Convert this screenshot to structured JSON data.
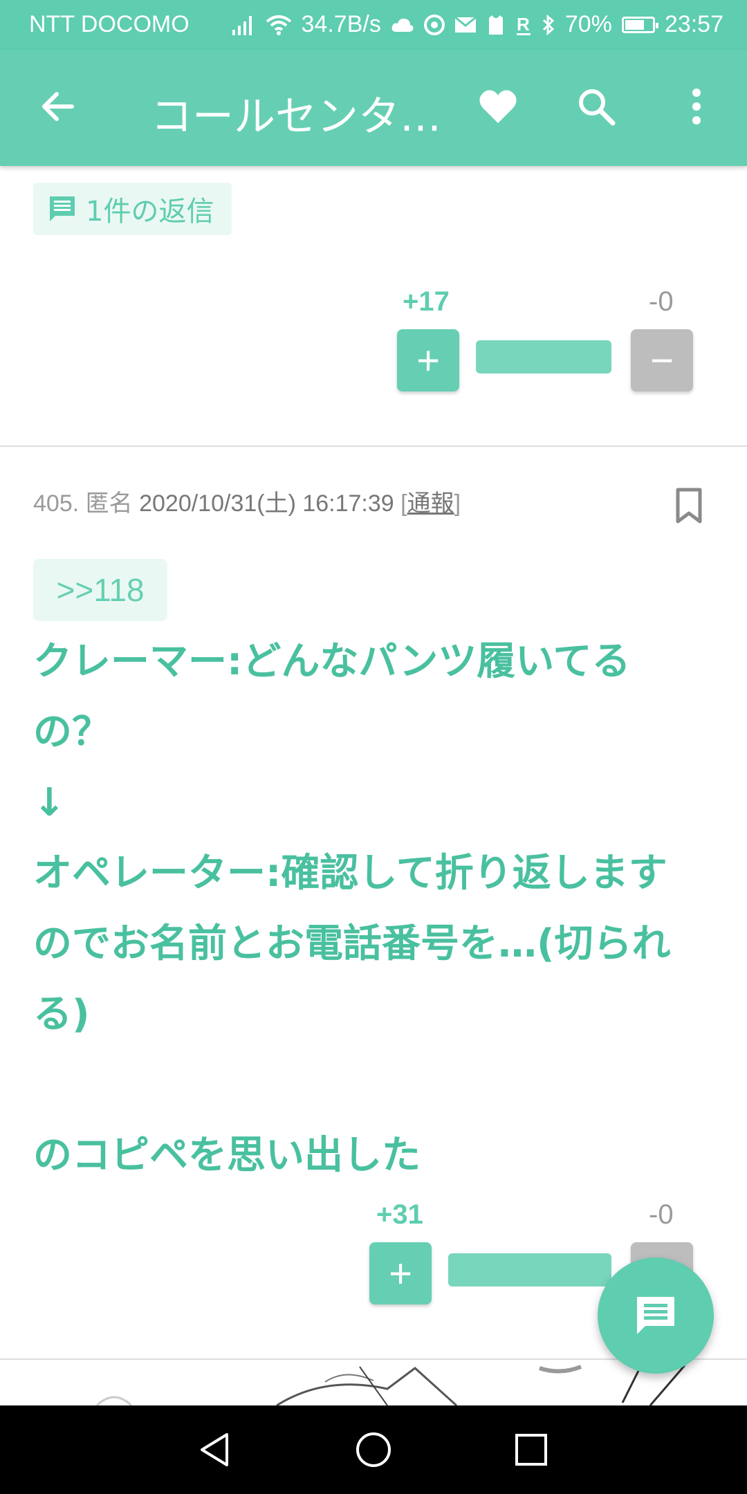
{
  "status_bar": {
    "carrier": "NTT DOCOMO",
    "net_speed": "34.7B/s",
    "battery": "70%",
    "battery_level": 0.7,
    "time": "23:57"
  },
  "app_bar": {
    "title": "コールセンタ…"
  },
  "reply_chip": {
    "label": "1件の返信"
  },
  "prev_post_votes": {
    "plus": "+17",
    "minus": "-0",
    "plus_symbol": "+",
    "minus_symbol": "−"
  },
  "post": {
    "number": "405.",
    "author": "匿名",
    "date": "2020/10/31(土) 16:17:39",
    "report_open": "[",
    "report": "通報",
    "report_close": "]",
    "anchor": ">>118",
    "lines": [
      "クレーマー:どんなパンツ履いてる",
      "の？",
      "↓",
      "オペレーター:確認して折り返します",
      "のでお名前とお電話番号を…(切られ",
      "る)",
      "",
      "のコピペを思い出した"
    ],
    "votes": {
      "plus": "+31",
      "minus": "-0",
      "plus_symbol": "+"
    }
  },
  "colors": {
    "accent": "#5ecdb0",
    "app_bar": "#66cfb3",
    "text_accent": "#49c09f"
  }
}
